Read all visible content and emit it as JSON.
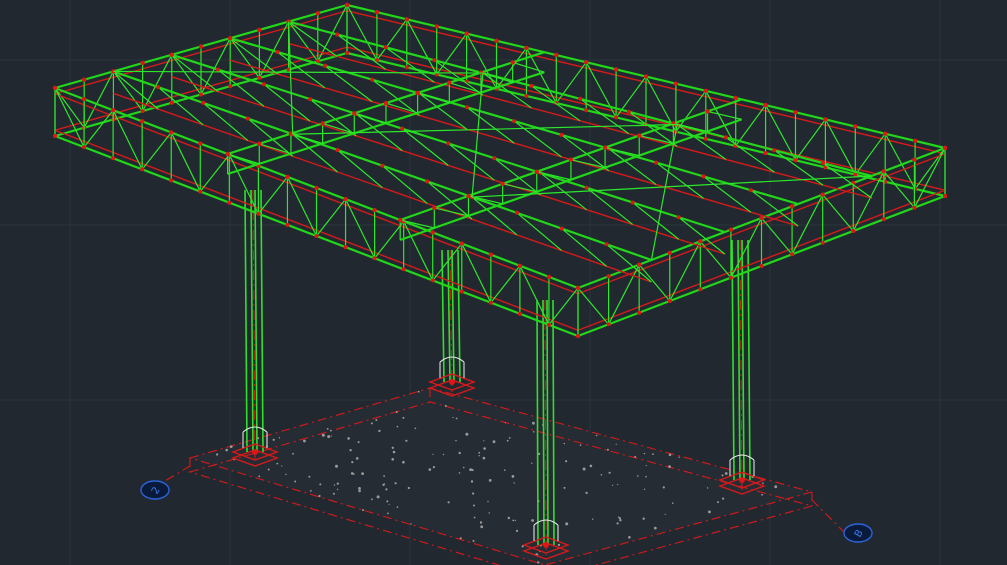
{
  "view": {
    "background": "#212830",
    "truss_color": "#22d61a",
    "connection_color": "#d61a1a",
    "grid_color": "#2b333c",
    "bubble_color": "#2a64d8"
  },
  "grid_bubbles": {
    "left": "2",
    "right": "B"
  }
}
